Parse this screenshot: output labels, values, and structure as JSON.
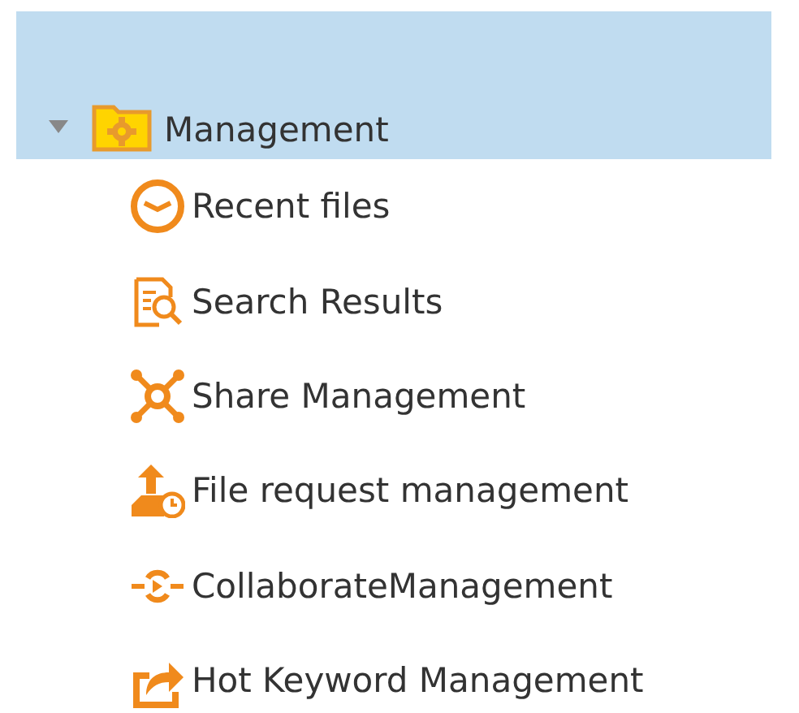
{
  "tree": {
    "label": "Management",
    "expanded": true,
    "selected": true,
    "children": [
      {
        "label": "Recent files",
        "kind": "clock",
        "selected": false
      },
      {
        "label": "Search Results",
        "kind": "search",
        "selected": false
      },
      {
        "label": "Share Management",
        "kind": "share",
        "selected": false
      },
      {
        "label": "File request management",
        "kind": "upload",
        "selected": false
      },
      {
        "label": "CollaborateManagement",
        "kind": "collab",
        "selected": false
      },
      {
        "label": "Hot Keyword Management",
        "kind": "forward",
        "selected": false
      }
    ]
  }
}
